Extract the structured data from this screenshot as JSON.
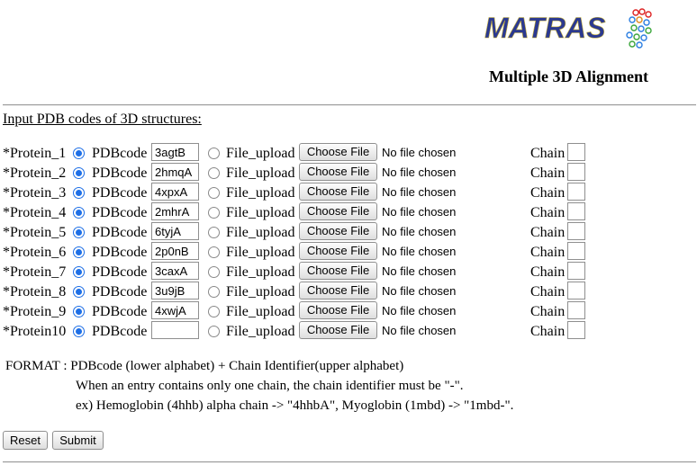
{
  "header": {
    "logo_text": "MATRAS",
    "subtitle": "Multiple 3D Alignment"
  },
  "form": {
    "heading": "Input PDB codes of 3D structures:",
    "option_pdb": "PDBcode",
    "option_file": "File_upload",
    "choose_file": "Choose File",
    "no_file": "No file chosen",
    "chain_label": "Chain",
    "proteins": [
      {
        "label": "*Protein_1",
        "pdbcode": "3agtB"
      },
      {
        "label": "*Protein_2",
        "pdbcode": "2hmqA"
      },
      {
        "label": "*Protein_3",
        "pdbcode": "4xpxA"
      },
      {
        "label": "*Protein_4",
        "pdbcode": "2mhrA"
      },
      {
        "label": "*Protein_5",
        "pdbcode": "6tyjA"
      },
      {
        "label": "*Protein_6",
        "pdbcode": "2p0nB"
      },
      {
        "label": "*Protein_7",
        "pdbcode": "3caxA"
      },
      {
        "label": "*Protein_8",
        "pdbcode": "3u9jB"
      },
      {
        "label": "*Protein_9",
        "pdbcode": "4xwjA"
      },
      {
        "label": "*Protein10",
        "pdbcode": ""
      }
    ]
  },
  "format": {
    "line1": "FORMAT : PDBcode (lower alphabet) + Chain Identifier(upper alphabet)",
    "line2": "When an entry contains only one chain, the chain identifier must be \"-\".",
    "line3": "ex) Hemoglobin (4hhb) alpha chain -> \"4hhbA\", Myoglobin (1mbd) -> \"1mbd-\"."
  },
  "buttons": {
    "reset": "Reset",
    "submit": "Submit"
  },
  "colors": {
    "logo_text": "#2b3990",
    "radio_selected": "#1e6fe6"
  }
}
